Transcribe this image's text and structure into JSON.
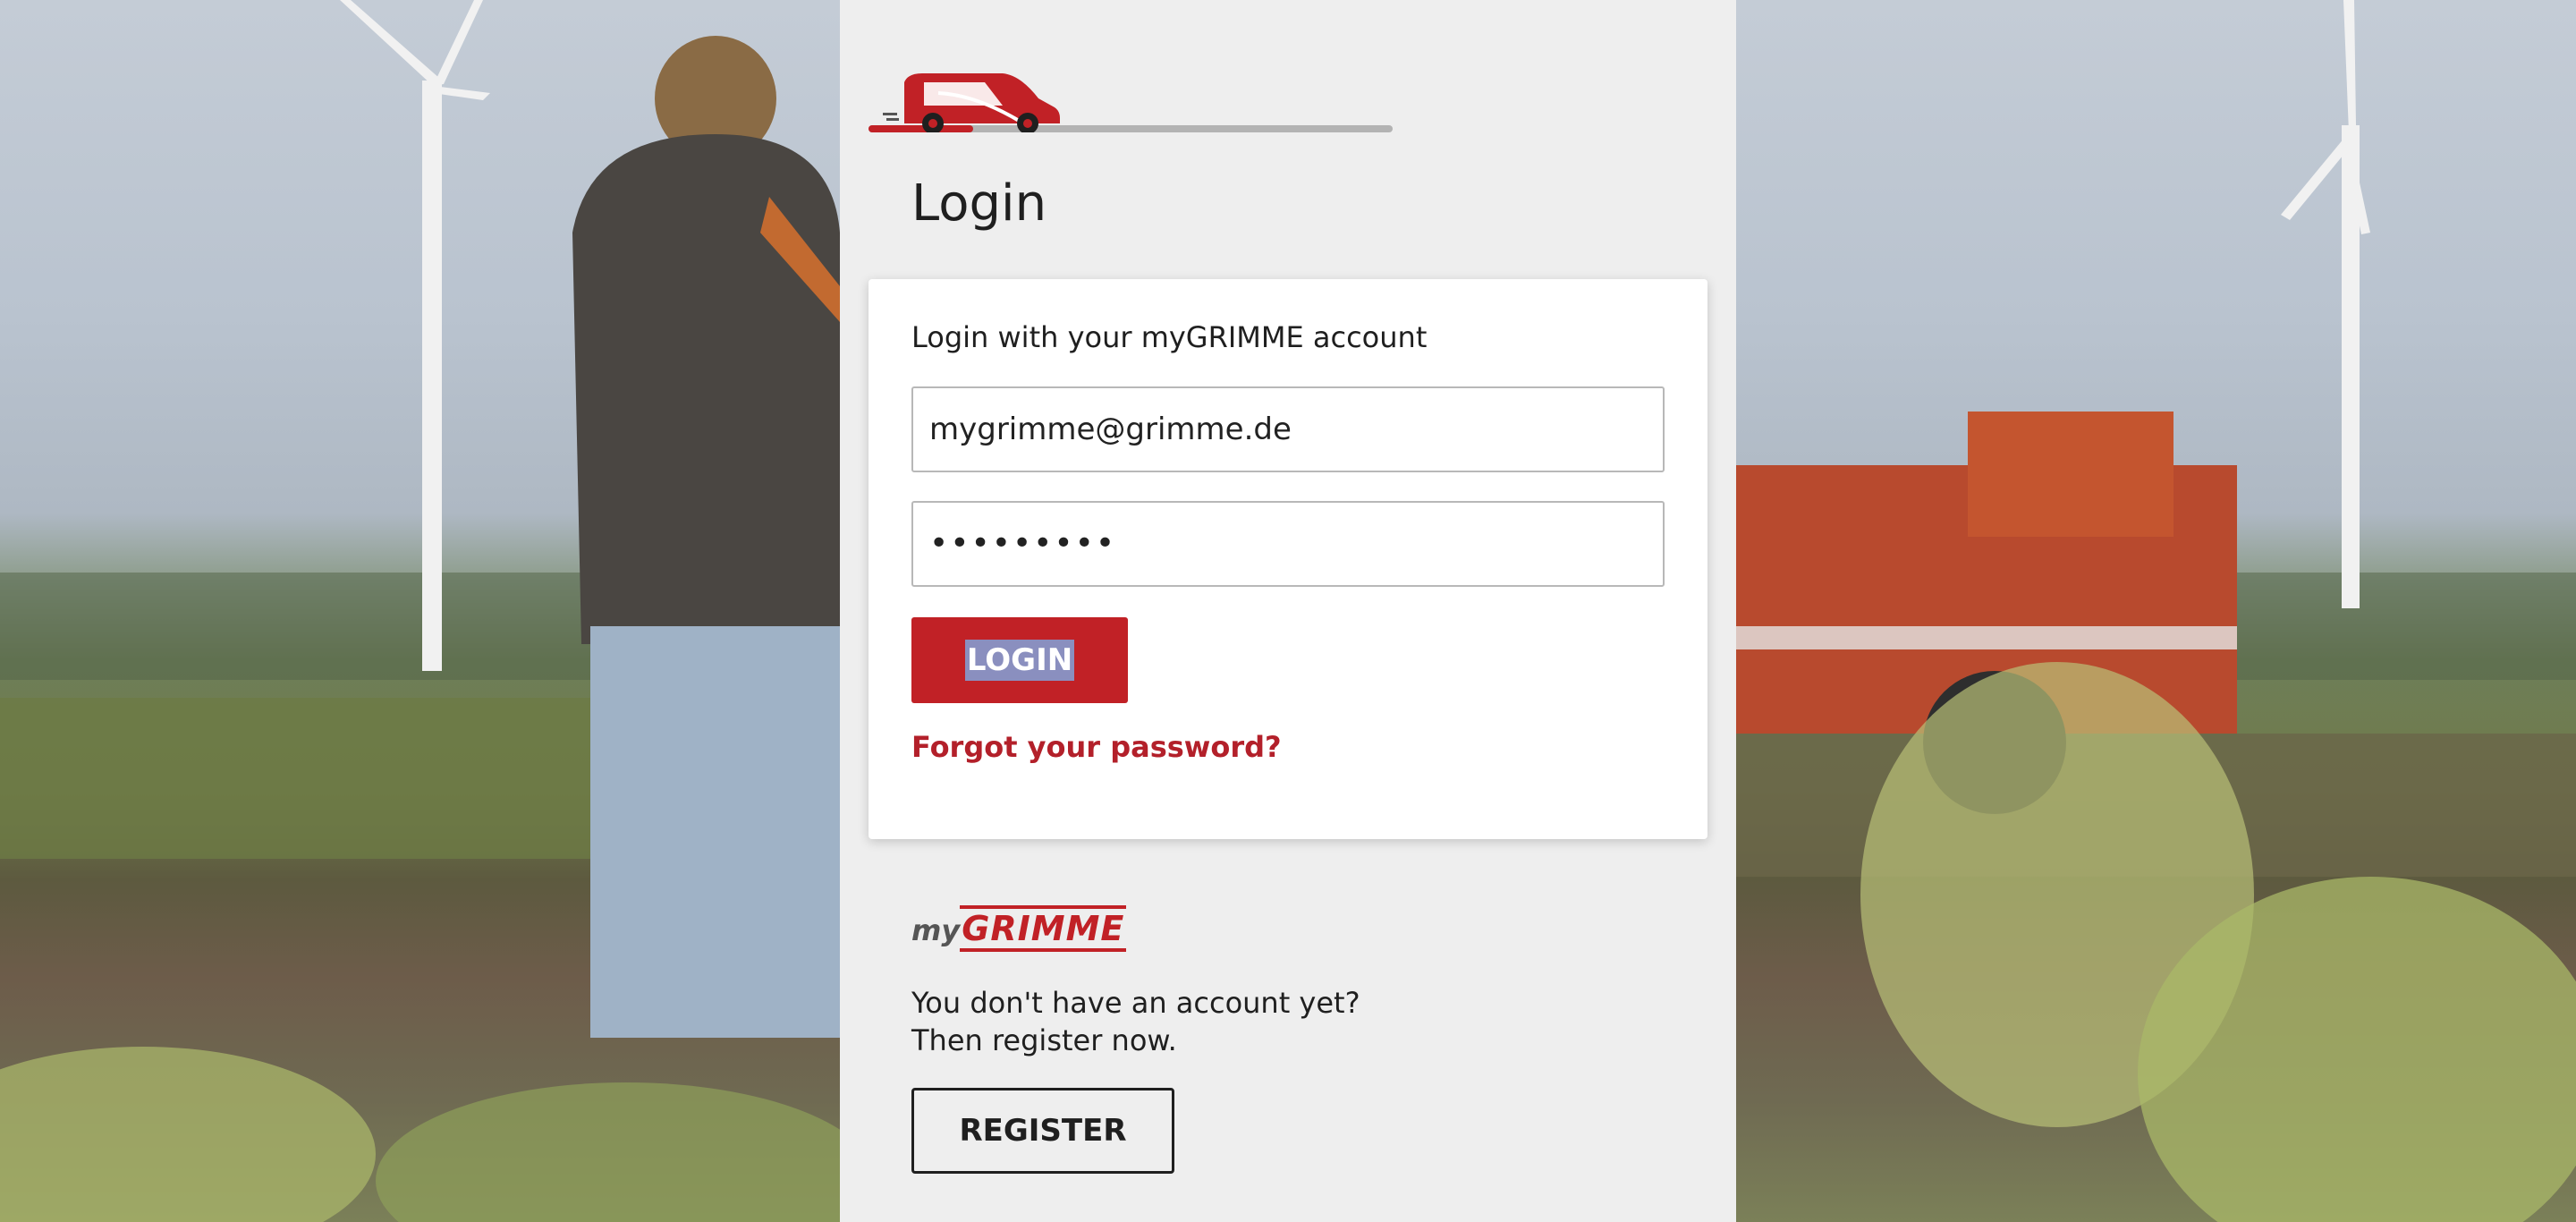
{
  "progress": {
    "fraction": 0.2
  },
  "page": {
    "title": "Login"
  },
  "login_card": {
    "heading": "Login with your myGRIMME account",
    "email_value": "mygrimme@grimme.de",
    "password_value": "•••••••••",
    "login_button": "LOGIN",
    "forgot_link": "Forgot your password?"
  },
  "brand": {
    "my": "my",
    "grimme": "GRIMME"
  },
  "register": {
    "line1": "You don't have an account yet?",
    "line2": "Then register now.",
    "button": "REGISTER"
  },
  "colors": {
    "accent": "#c12126",
    "panel_bg": "#eeeeee",
    "card_bg": "#ffffff"
  },
  "icons": {
    "progress": "van-icon"
  }
}
